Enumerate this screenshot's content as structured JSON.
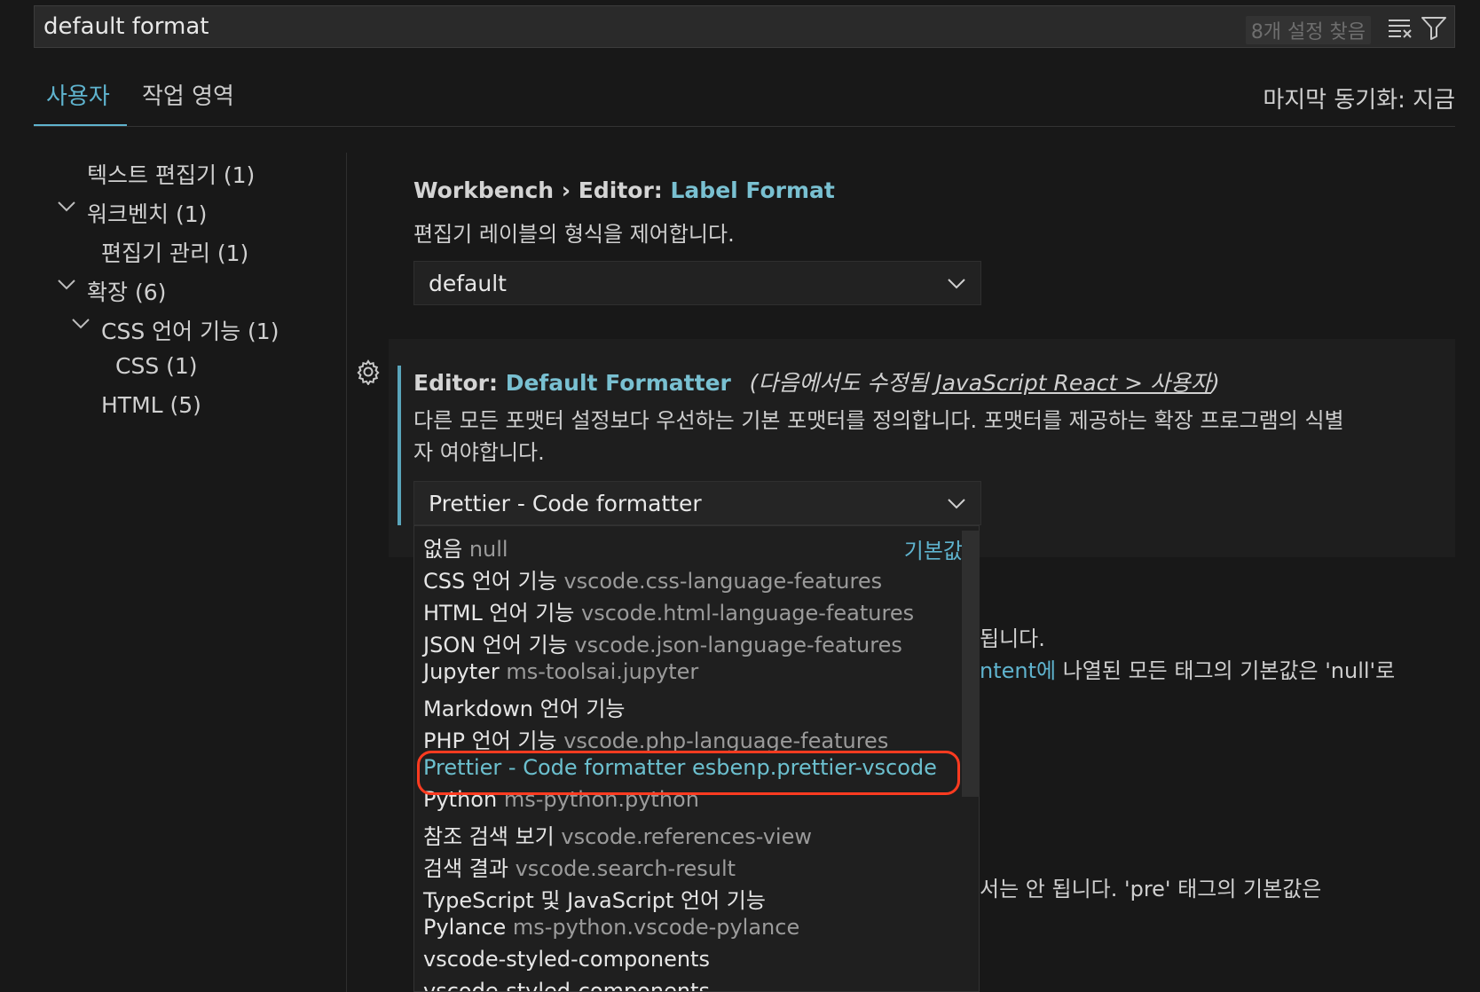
{
  "search": {
    "value": "default format",
    "result_count": "8개 설정 찾음",
    "clear_icon": "clear-filter-icon",
    "filter_icon": "filter-icon"
  },
  "tabs": [
    {
      "label": "사용자",
      "active": true
    },
    {
      "label": "작업 영역",
      "active": false
    }
  ],
  "sync_status": "마지막 동기화: 지금",
  "tree": [
    {
      "label": "텍스트 편집기 (1)",
      "expanded": null
    },
    {
      "label": "워크벤치 (1)",
      "expanded": true
    },
    {
      "label": "편집기 관리 (1)",
      "expanded": null
    },
    {
      "label": "확장 (6)",
      "expanded": true
    },
    {
      "label": "CSS 언어 기능 (1)",
      "expanded": true
    },
    {
      "label": "CSS (1)",
      "expanded": null
    },
    {
      "label": "HTML (5)",
      "expanded": null
    }
  ],
  "settings": [
    {
      "prefix": "Workbench › Editor: ",
      "name": "Label Format",
      "description": "편집기 레이블의 형식을 제어합니다.",
      "value": "default"
    },
    {
      "prefix": "Editor: ",
      "name": "Default Formatter",
      "modified_prefix": "(다음에서도 수정됨 ",
      "modified_link": "JavaScript React > 사용자",
      "modified_suffix": ")",
      "description_line1": "다른 모든 포맷터 설정보다 우선하는 기본 포맷터를 정의합니다. 포맷터를 제공하는 확장 프로그램의 식별",
      "description_line2": "자 여야합니다.",
      "value": "Prettier - Code formatter"
    }
  ],
  "background_text": {
    "line1": "됩니다.",
    "line2_link": "ntent에",
    "line2_rest": " 나열된 모든 태그의 기본값은 'null'로",
    "line3": "서는 안 됩니다. 'pre' 태그의 기본값은"
  },
  "dropdown": {
    "default_tag": "기본값",
    "options": [
      {
        "name": "없음",
        "id": "null"
      },
      {
        "name": "CSS 언어 기능",
        "id": "vscode.css-language-features"
      },
      {
        "name": "HTML 언어 기능",
        "id": "vscode.html-language-features"
      },
      {
        "name": "JSON 언어 기능",
        "id": "vscode.json-language-features"
      },
      {
        "name": "Jupyter",
        "id": "ms-toolsai.jupyter"
      },
      {
        "name": "Markdown 언어 기능",
        "id": ""
      },
      {
        "name": "PHP 언어 기능",
        "id": "vscode.php-language-features"
      },
      {
        "name": "Prettier - Code formatter",
        "id": "esbenp.prettier-vscode",
        "selected": true
      },
      {
        "name": "Python",
        "id": "ms-python.python"
      },
      {
        "name": "참조 검색 보기",
        "id": "vscode.references-view"
      },
      {
        "name": "검색 결과",
        "id": "vscode.search-result"
      },
      {
        "name": "TypeScript 및 JavaScript 언어 기능",
        "id": ""
      },
      {
        "name": "Pylance",
        "id": "ms-python.vscode-pylance"
      },
      {
        "name": "vscode-styled-components",
        "id": ""
      },
      {
        "name": "vscode-styled-components",
        "id": ""
      }
    ]
  },
  "colors": {
    "accent": "#5fb3ce",
    "highlight_ring": "#ff3b20"
  }
}
